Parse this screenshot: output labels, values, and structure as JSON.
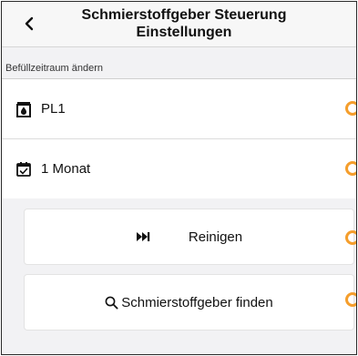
{
  "header": {
    "back_icon": "chevron-left-icon",
    "title_line1": "Schmierstoffgeber Steuerung",
    "title_line2": "Einstellungen"
  },
  "section": {
    "label": "Befüllzeitraum ändern"
  },
  "rows": [
    {
      "icon": "lubricator-device-icon",
      "label": "PL1"
    },
    {
      "icon": "calendar-check-icon",
      "label": "1 Monat"
    }
  ],
  "actions": [
    {
      "icon": "skip-forward-icon",
      "label": "Reinigen"
    },
    {
      "icon": "search-icon",
      "label": "Schmierstoffgeber finden"
    }
  ],
  "colors": {
    "accent": "#f59e2c",
    "background": "#f2f2f4",
    "header": "#f7f7f7"
  }
}
